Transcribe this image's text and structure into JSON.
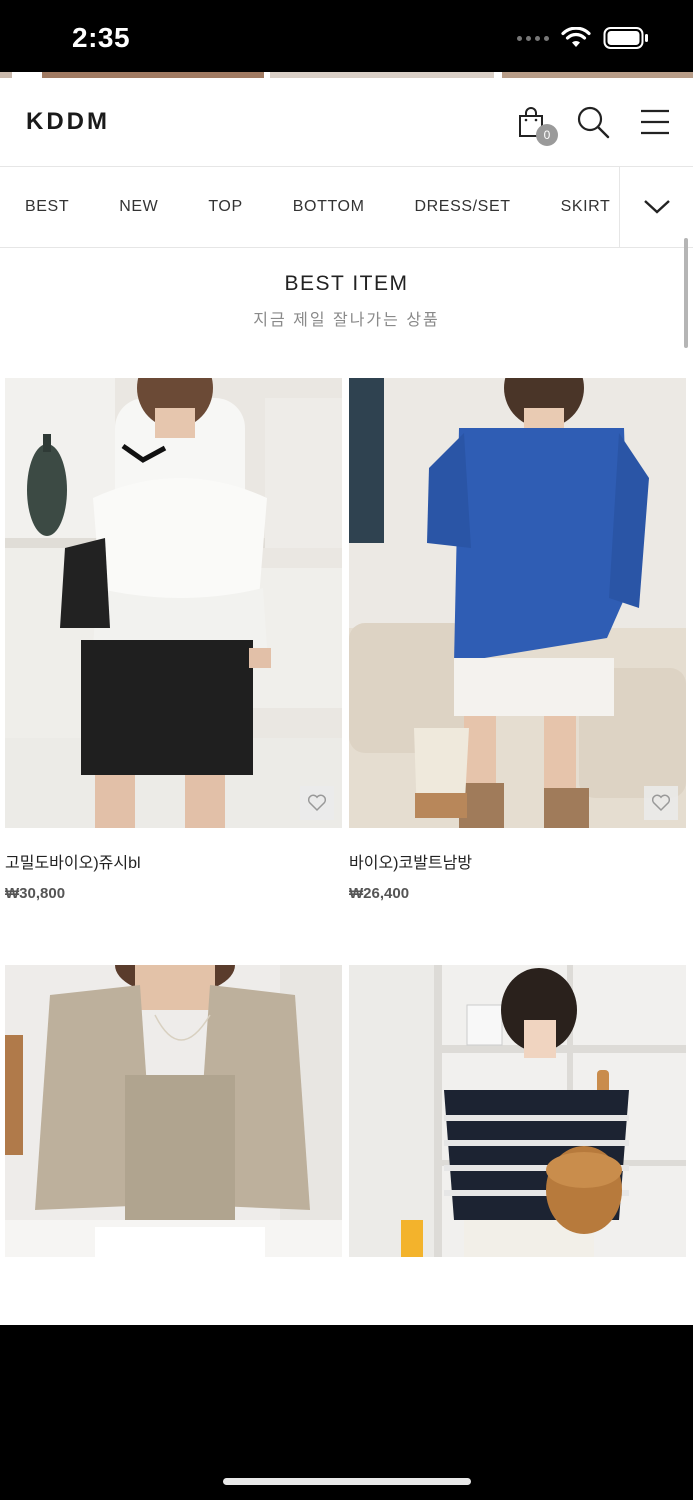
{
  "status_bar": {
    "time": "2:35"
  },
  "header": {
    "logo": "KDDM",
    "cart_count": "0"
  },
  "categories": [
    "BEST",
    "NEW",
    "TOP",
    "BOTTOM",
    "DRESS/SET",
    "SKIRT"
  ],
  "section": {
    "title": "BEST ITEM",
    "subtitle": "지금 제일 잘나가는 상품"
  },
  "products": [
    {
      "name": "고밀도바이오)쥬시bl",
      "price": "₩30,800"
    },
    {
      "name": "바이오)코발트남방",
      "price": "₩26,400"
    },
    {
      "name": "",
      "price": ""
    },
    {
      "name": "",
      "price": ""
    }
  ],
  "colors": {
    "accent": "#1a1a1a",
    "badge": "#9a9a9a",
    "price": "#555555"
  }
}
